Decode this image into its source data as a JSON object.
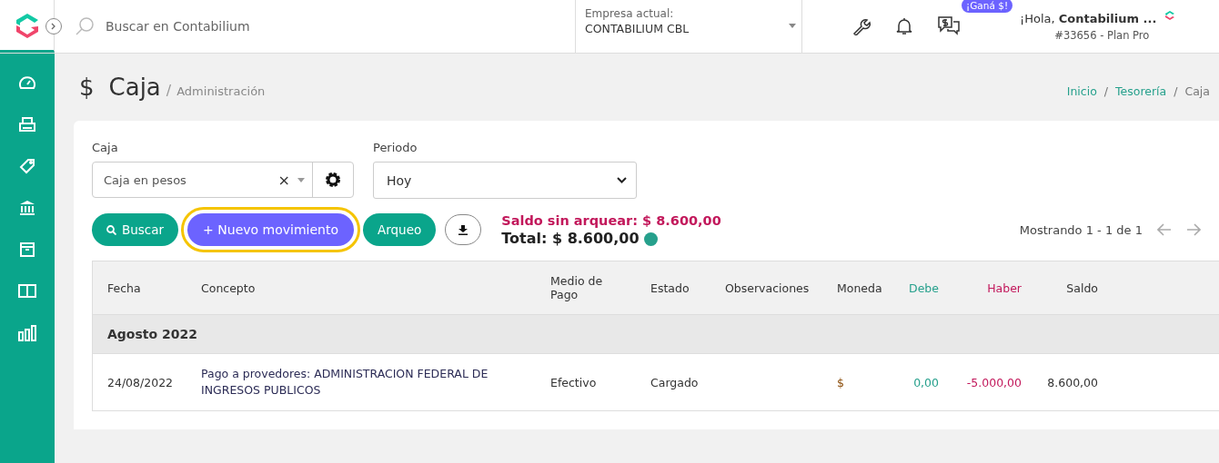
{
  "topbar": {
    "search": {
      "placeholder": "Buscar en Contabilium"
    },
    "company": {
      "label": "Empresa actual:",
      "value": "CONTABILIUM CBL"
    },
    "promo_badge": "¡Ganá $!",
    "user": {
      "greeting": "¡Hola, ",
      "name": "Contabilium ...",
      "account": "#33656 - Plan Pro"
    }
  },
  "sidebar": {
    "items": [
      {
        "selected": false
      },
      {
        "selected": false
      },
      {
        "selected": false
      },
      {
        "selected": false
      },
      {
        "selected": false
      },
      {
        "selected": false
      },
      {
        "selected": false
      }
    ]
  },
  "page": {
    "icon": "$",
    "title": "Caja",
    "title_separator": "/",
    "subtitle": "Administración",
    "breadcrumb": [
      {
        "kind": "link",
        "label": "Inicio"
      },
      {
        "kind": "separator",
        "label": "/"
      },
      {
        "kind": "link",
        "label": "Tesorería"
      },
      {
        "kind": "separator",
        "label": "/"
      },
      {
        "kind": "current",
        "label": "Caja"
      }
    ]
  },
  "filters": {
    "caja": {
      "label": "Caja",
      "value": "Caja en pesos",
      "clear": "×"
    },
    "periodo": {
      "label": "Periodo",
      "value": "Hoy"
    }
  },
  "actions": [
    {
      "kind": "search",
      "label": "Buscar",
      "highlighted": false
    },
    {
      "kind": "add",
      "label": "+ Nuevo movimiento",
      "highlighted": true
    },
    {
      "kind": "plain",
      "label": "Arqueo",
      "highlighted": false
    },
    {
      "kind": "download",
      "highlighted": false
    }
  ],
  "summary": {
    "pending": "Saldo sin arquear: $ 8.600,00",
    "total": "Total: $ 8.600,00"
  },
  "pagination": {
    "text": "Mostrando 1 - 1 de 1"
  },
  "table": {
    "columns": [
      {
        "label": "Fecha"
      },
      {
        "label": "Concepto"
      },
      {
        "label": "Medio de Pago"
      },
      {
        "label": "Estado"
      },
      {
        "label": "Observaciones"
      },
      {
        "label": "Moneda"
      },
      {
        "label": "Debe",
        "color": "#26a08c"
      },
      {
        "label": "Haber",
        "color": "#c2185b"
      },
      {
        "label": "Saldo"
      }
    ],
    "rows": [
      {
        "kind": "group",
        "label": "Agosto 2022"
      },
      {
        "kind": "data",
        "cells": [
          "24/08/2022",
          "Pago a provedores: ADMINISTRACION FEDERAL DE INGRESOS PUBLICOS",
          "Efectivo",
          "Cargado",
          "",
          "$",
          "0,00",
          "-5.000,00",
          "8.600,00"
        ]
      }
    ]
  }
}
